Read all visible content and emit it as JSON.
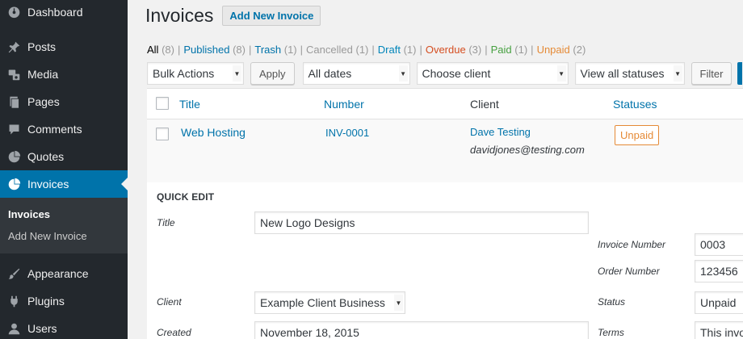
{
  "sidebar": {
    "items": [
      {
        "label": "Dashboard",
        "icon": "dashboard-icon"
      },
      {
        "label": "Posts",
        "icon": "pin-icon"
      },
      {
        "label": "Media",
        "icon": "media-icon"
      },
      {
        "label": "Pages",
        "icon": "pages-icon"
      },
      {
        "label": "Comments",
        "icon": "comments-icon"
      },
      {
        "label": "Quotes",
        "icon": "pie-chart-icon"
      },
      {
        "label": "Invoices",
        "icon": "pie-chart-icon"
      },
      {
        "label": "Appearance",
        "icon": "brush-icon"
      },
      {
        "label": "Plugins",
        "icon": "plug-icon"
      },
      {
        "label": "Users",
        "icon": "user-icon"
      }
    ],
    "submenu": [
      "Invoices",
      "Add New Invoice"
    ]
  },
  "header": {
    "title": "Invoices",
    "add_new": "Add New Invoice"
  },
  "filters": {
    "all": {
      "label": "All",
      "count": "(8)"
    },
    "published": {
      "label": "Published",
      "count": "(8)"
    },
    "trash": {
      "label": "Trash",
      "count": "(1)"
    },
    "cancelled": {
      "label": "Cancelled",
      "count": "(1)"
    },
    "draft": {
      "label": "Draft",
      "count": "(1)"
    },
    "overdue": {
      "label": "Overdue",
      "count": "(3)"
    },
    "paid": {
      "label": "Paid",
      "count": "(1)"
    },
    "unpaid": {
      "label": "Unpaid",
      "count": "(2)"
    },
    "separator": "|"
  },
  "tablenav": {
    "bulk_actions": "Bulk Actions",
    "apply": "Apply",
    "dates": "All dates",
    "client": "Choose client",
    "statuses": "View all statuses",
    "filter": "Filter"
  },
  "table": {
    "columns": {
      "title": "Title",
      "number": "Number",
      "client": "Client",
      "statuses": "Statuses"
    },
    "row": {
      "title": "Web Hosting",
      "number": "INV-0001",
      "client_name": "Dave Testing",
      "client_email": "davidjones@testing.com",
      "status": "Unpaid"
    }
  },
  "quick_edit": {
    "heading": "QUICK EDIT",
    "title_label": "Title",
    "title_value": "New Logo Designs",
    "invoice_number_label": "Invoice Number",
    "invoice_number_value": "0003",
    "order_number_label": "Order Number",
    "order_number_value": "123456",
    "client_label": "Client",
    "client_value": "Example Client Business",
    "status_label": "Status",
    "status_value": "Unpaid",
    "created_label": "Created",
    "created_value": "November 18, 2015",
    "terms_label": "Terms",
    "terms_value": "This invo"
  },
  "colors": {
    "sidebar_bg": "#23282d",
    "active_bg": "#0073aa",
    "link": "#0073aa",
    "cancelled": "#999999",
    "overdue": "#d54e21",
    "paid": "#46a040",
    "unpaid": "#e58a36"
  }
}
